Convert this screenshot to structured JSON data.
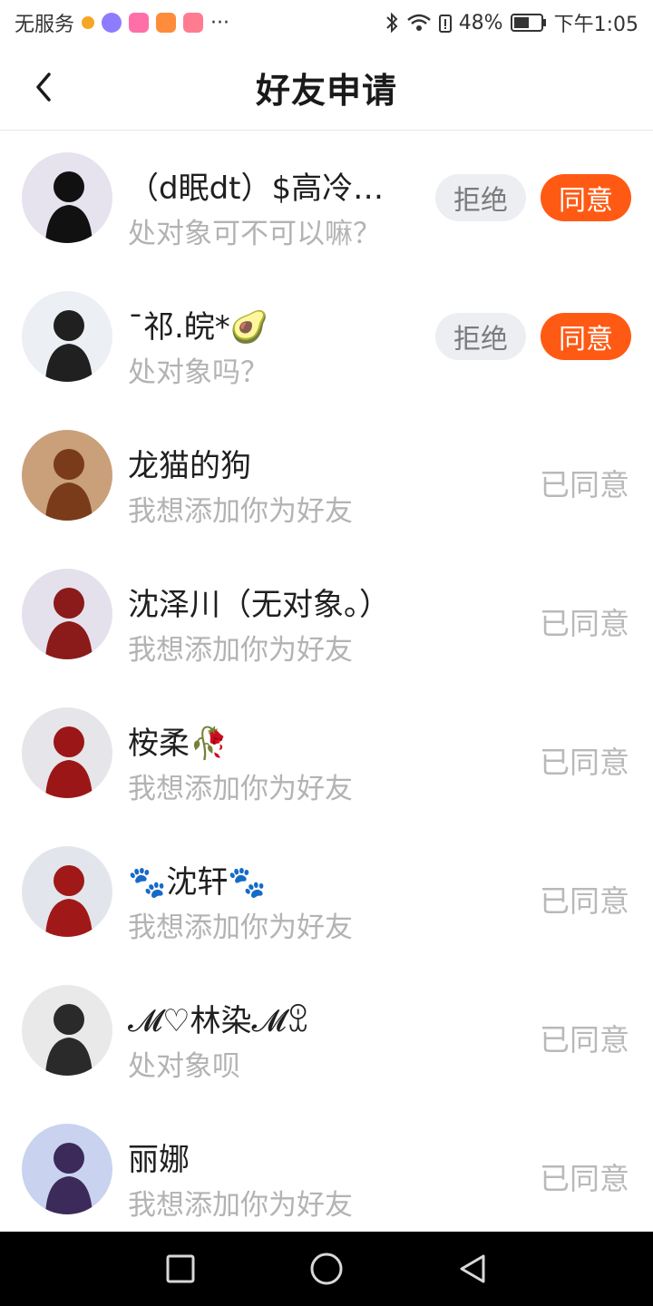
{
  "status_bar": {
    "carrier": "无服务",
    "battery": "48%",
    "time": "下午1:05",
    "more": "···",
    "colors": {
      "app1": "#f5a623",
      "app2": "#8e7cff",
      "app3": "#ff6fa8",
      "app4": "#ff8c3a",
      "app5": "#ff7b8f"
    }
  },
  "header": {
    "title": "好友申请",
    "back_icon": "chevron-left-icon"
  },
  "buttons": {
    "reject": "拒绝",
    "agree": "同意"
  },
  "requests": [
    {
      "name": "（d眠dt）$高冷…",
      "message": "处对象可不可以嘛？",
      "state": "pending",
      "avatar_bg": "#e6e2ee",
      "avatar_fg": "#111111"
    },
    {
      "name": "ˉ祁.皖*🥑",
      "message": "处对象吗？",
      "state": "pending",
      "avatar_bg": "#eceff3",
      "avatar_fg": "#202020"
    },
    {
      "name": "龙猫的狗",
      "message": "我想添加你为好友",
      "state": "accepted",
      "status_text": "已同意",
      "avatar_bg": "#c9a07a",
      "avatar_fg": "#7a3b1a"
    },
    {
      "name": "沈泽川（无对象。）",
      "message": "我想添加你为好友",
      "state": "accepted",
      "status_text": "已同意",
      "avatar_bg": "#e4e1ec",
      "avatar_fg": "#8b1a1a"
    },
    {
      "name": "桉柔🥀",
      "message": "我想添加你为好友",
      "state": "accepted",
      "status_text": "已同意",
      "avatar_bg": "#e6e6ea",
      "avatar_fg": "#9b1616"
    },
    {
      "name": "🐾沈轩🐾",
      "message": "我想添加你为好友",
      "state": "accepted",
      "status_text": "已同意",
      "avatar_bg": "#e2e6ec",
      "avatar_fg": "#a01818"
    },
    {
      "name": "𝓜♡林染𝓜ꀾ",
      "message": "处对象呗",
      "state": "accepted",
      "status_text": "已同意",
      "avatar_bg": "#e9e9e9",
      "avatar_fg": "#2a2a2a"
    },
    {
      "name": "丽娜",
      "message": "我想添加你为好友",
      "state": "accepted",
      "status_text": "已同意",
      "avatar_bg": "#c9d3f0",
      "avatar_fg": "#3b2a5a"
    }
  ],
  "colors": {
    "accent": "#ff5a14",
    "reject_bg": "#eceef2",
    "muted": "#b3b3b3"
  },
  "system_nav": {
    "recent_icon": "square-icon",
    "home_icon": "circle-icon",
    "back_icon": "triangle-back-icon"
  }
}
